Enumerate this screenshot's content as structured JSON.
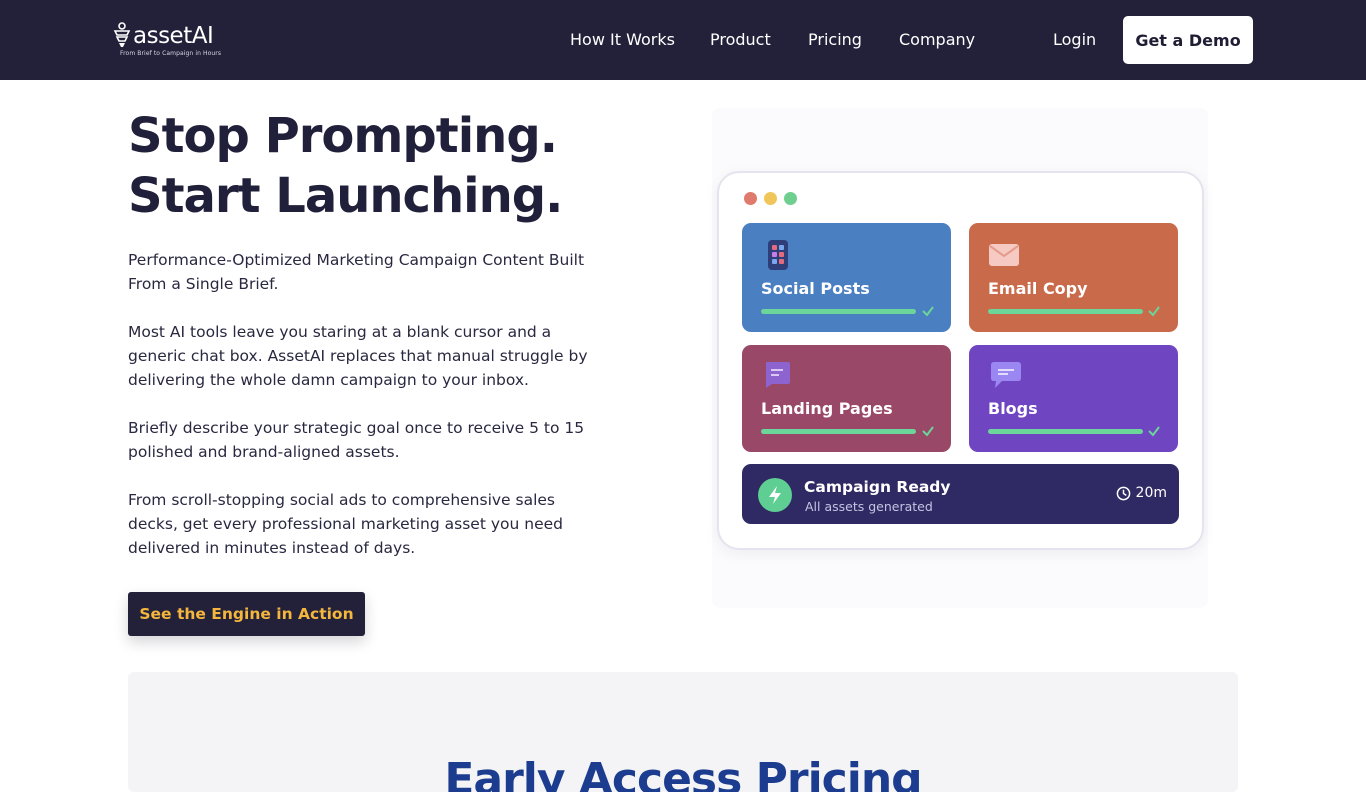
{
  "nav": {
    "logo_text": "assetAI",
    "logo_tagline": "From Brief to Campaign in Hours",
    "links": [
      "How It Works",
      "Product",
      "Pricing",
      "Company"
    ],
    "login": "Login",
    "demo": "Get a Demo"
  },
  "hero": {
    "title_line1": "Stop Prompting.",
    "title_line2": "Start Launching.",
    "paragraphs": [
      "Performance-Optimized Marketing Campaign Content Built From a Single Brief.",
      "Most AI tools leave you staring at a blank cursor and a generic chat box. AssetAI replaces that manual struggle by delivering the whole damn campaign to your inbox.",
      "Briefly describe your strategic goal once to receive 5 to 15 polished and brand-aligned assets.",
      "From scroll-stopping social ads to comprehensive sales decks, get every professional marketing asset you need delivered in minutes instead of days."
    ],
    "cta": "See the Engine in Action"
  },
  "mockup": {
    "tiles": [
      {
        "label": "Social Posts",
        "color": "#4a7fc1",
        "icon": "phone-icon"
      },
      {
        "label": "Email Copy",
        "color": "#c96a4a",
        "icon": "envelope-icon"
      },
      {
        "label": "Landing Pages",
        "color": "#9a4867",
        "icon": "document-icon"
      },
      {
        "label": "Blogs",
        "color": "#6f45c2",
        "icon": "chat-icon"
      }
    ],
    "status": {
      "title": "Campaign Ready",
      "subtitle": "All assets generated",
      "time": "20m"
    },
    "dot_colors": [
      "#e07a6d",
      "#f0c65a",
      "#6fcf8f"
    ]
  },
  "lower": {
    "title": "Early Access Pricing"
  },
  "colors": {
    "nav_bg": "#23213a",
    "cta_text": "#f4b63c",
    "accent_green": "#6bd59a"
  }
}
